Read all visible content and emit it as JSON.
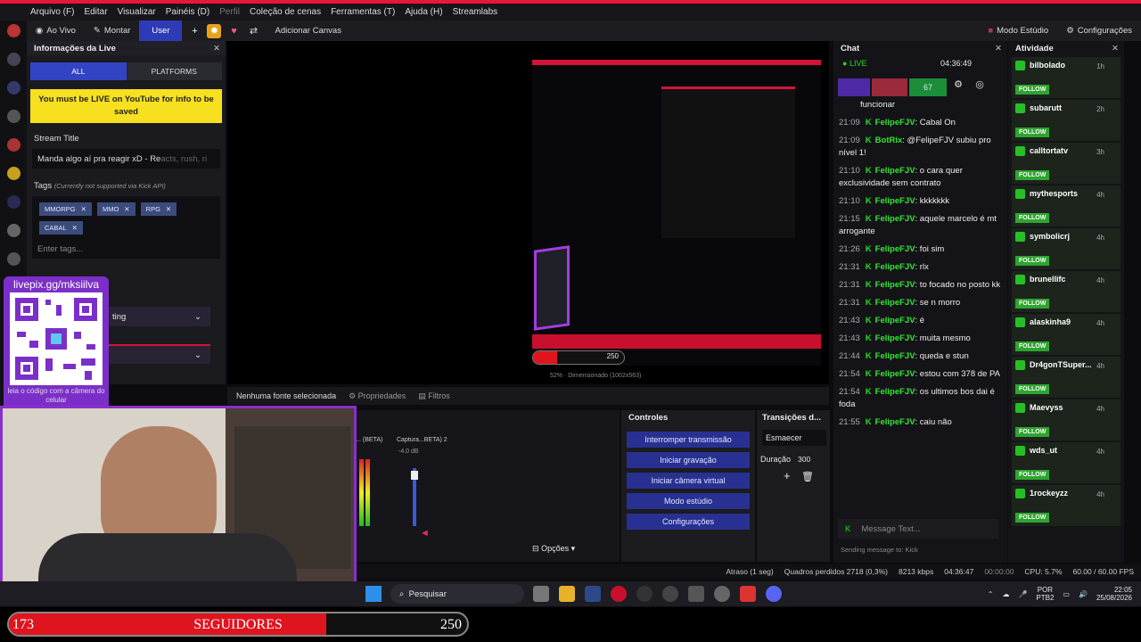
{
  "menu": [
    "Arquivo (F)",
    "Editar",
    "Visualizar",
    "Painéis (D)",
    "Perfil",
    "Coleção de cenas",
    "Ferramentas (T)",
    "Ajuda (H)",
    "Streamlabs"
  ],
  "toolbar": {
    "ao_vivo": "Ao Vivo",
    "montar": "Montar",
    "user": "User",
    "canvas": "Adicionar Canvas",
    "studio": "Modo Estúdio",
    "config": "Configurações"
  },
  "live_info": {
    "title": "Informações da Live",
    "tabs": [
      "ALL",
      "PLATFORMS"
    ],
    "warning": "You must be LIVE on YouTube for info to be saved",
    "stream_title_label": "Stream Title",
    "stream_title": "Manda algo aí pra reagir xD - Re",
    "stream_title_faded": "acts, rush, ri",
    "tags_label": "Tags",
    "tags_note": "(Currently not supported via Kick API)",
    "tags": [
      "MMORPG",
      "MMO",
      "RPG",
      "CABAL"
    ],
    "tags_placeholder": "Enter tags...",
    "dropdown": "ting"
  },
  "overlay": {
    "qr_url": "livepix.gg/mksiilva",
    "qr_caption": "leia o código com a câmera do celular",
    "followers_count": "173",
    "followers_label": "SEGUIDORES",
    "followers_goal": "250",
    "follow_progress": 0.692,
    "preview_progress_label": "250"
  },
  "preview": {
    "zoom": "52%",
    "dims": "Dimensionado (1002x563)"
  },
  "status": {
    "no_source": "Nenhuma fonte selecionada",
    "props": "Propriedades",
    "filters": "Filtros"
  },
  "mixer": {
    "ch1": "ura... (BETA)",
    "ch2": "Captura...BETA) 2",
    "db": "-4.0 dB",
    "opts": "Opções"
  },
  "controls": {
    "title": "Controles",
    "buttons": [
      "Interromper transmissão",
      "Iniciar gravação",
      "Iniciar câmera virtual",
      "Modo estúdio",
      "Configurações"
    ]
  },
  "transitions": {
    "title": "Transições d...",
    "type": "Esmaecer",
    "dur_label": "Duração",
    "dur": "300"
  },
  "chat": {
    "title": "Chat",
    "live": "LIVE",
    "time": "04:36:49",
    "viewers": "67",
    "first_line": "funcionar",
    "messages": [
      {
        "t": "21:09",
        "u": "FelipeFJV",
        "m": ": Cabal On"
      },
      {
        "t": "21:09",
        "u": "BotRix",
        "m": ": @FelipeFJV subiu pro nível 1!"
      },
      {
        "t": "21:10",
        "u": "FelipeFJV",
        "m": ": o cara quer exclusividade sem contrato"
      },
      {
        "t": "21:10",
        "u": "FelipeFJV",
        "m": ": kkkkkkk"
      },
      {
        "t": "21:15",
        "u": "FelipeFJV",
        "m": ": aquele marcelo é mt arrogante"
      },
      {
        "t": "21:26",
        "u": "FelipeFJV",
        "m": ": foi sim"
      },
      {
        "t": "21:31",
        "u": "FelipeFJV",
        "m": ": rlx"
      },
      {
        "t": "21:31",
        "u": "FelipeFJV",
        "m": ": to focado no posto kk"
      },
      {
        "t": "21:31",
        "u": "FelipeFJV",
        "m": ": se n morro"
      },
      {
        "t": "21:43",
        "u": "FelipeFJV",
        "m": ": é"
      },
      {
        "t": "21:43",
        "u": "FelipeFJV",
        "m": ": muita mesmo"
      },
      {
        "t": "21:44",
        "u": "FelipeFJV",
        "m": ": queda e stun"
      },
      {
        "t": "21:54",
        "u": "FelipeFJV",
        "m": ": estou com 378 de PA"
      },
      {
        "t": "21:54",
        "u": "FelipeFJV",
        "m": ": os ultimos bos dai é foda"
      },
      {
        "t": "21:55",
        "u": "FelipeFJV",
        "m": ": caiu não"
      }
    ],
    "placeholder": "Message Text...",
    "sending": "Sending message to: Kick"
  },
  "activity": {
    "title": "Atividade",
    "follow": "FOLLOW",
    "items": [
      {
        "n": "bilbolado",
        "t": "1h"
      },
      {
        "n": "subarutt",
        "t": "2h"
      },
      {
        "n": "calltortatv",
        "t": "3h"
      },
      {
        "n": "mythesports",
        "t": "4h"
      },
      {
        "n": "symbolicrj",
        "t": "4h"
      },
      {
        "n": "brunellifc",
        "t": "4h"
      },
      {
        "n": "alaskinha9",
        "t": "4h"
      },
      {
        "n": "Dr4gonTSuper...",
        "t": "4h"
      },
      {
        "n": "Maevyss",
        "t": "4h"
      },
      {
        "n": "wds_ut",
        "t": "4h"
      },
      {
        "n": "1rockeyzz",
        "t": "4h"
      }
    ]
  },
  "bottom": {
    "delay": "Atraso (1 seg)",
    "frames": "Quadros perdidos 2718 (0,3%)",
    "kbps": "8213 kbps",
    "rec": "04:36:47",
    "rec2": "00:00:00",
    "cpu": "CPU: 5.7%",
    "fps": "60.00 / 60.00 FPS"
  },
  "taskbar": {
    "search": "Pesquisar",
    "lang": "POR",
    "lang2": "PTB2",
    "time": "22:05",
    "date": "25/08/2026"
  }
}
